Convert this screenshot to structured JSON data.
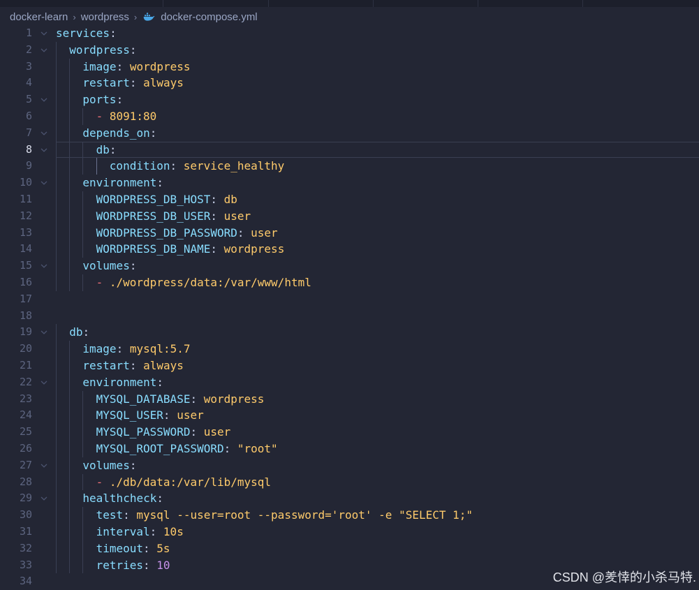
{
  "breadcrumb": {
    "items": [
      "docker-learn",
      "wordpress"
    ],
    "file": "docker-compose.yml",
    "file_icon": "docker-whale-icon"
  },
  "editor": {
    "active_line": 8,
    "lines": [
      {
        "no": "1",
        "indent": 0,
        "seg": [
          [
            "k",
            "services"
          ],
          [
            "p",
            ":"
          ]
        ],
        "fold": true
      },
      {
        "no": "2",
        "indent": 1,
        "seg": [
          [
            "k",
            "wordpress"
          ],
          [
            "p",
            ":"
          ]
        ],
        "fold": true
      },
      {
        "no": "3",
        "indent": 2,
        "seg": [
          [
            "k",
            "image"
          ],
          [
            "p",
            ": "
          ],
          [
            "v",
            "wordpress"
          ]
        ]
      },
      {
        "no": "4",
        "indent": 2,
        "seg": [
          [
            "k",
            "restart"
          ],
          [
            "p",
            ": "
          ],
          [
            "v",
            "always"
          ]
        ]
      },
      {
        "no": "5",
        "indent": 2,
        "seg": [
          [
            "k",
            "ports"
          ],
          [
            "p",
            ":"
          ]
        ],
        "fold": true
      },
      {
        "no": "6",
        "indent": 3,
        "seg": [
          [
            "dash",
            "- "
          ],
          [
            "v",
            "8091:80"
          ]
        ]
      },
      {
        "no": "7",
        "indent": 2,
        "seg": [
          [
            "k",
            "depends_on"
          ],
          [
            "p",
            ":"
          ]
        ],
        "fold": true
      },
      {
        "no": "8",
        "indent": 3,
        "seg": [
          [
            "k",
            "db"
          ],
          [
            "p",
            ":"
          ]
        ],
        "fold": true
      },
      {
        "no": "9",
        "indent": 4,
        "seg": [
          [
            "k",
            "condition"
          ],
          [
            "p",
            ": "
          ],
          [
            "v",
            "service_healthy"
          ]
        ]
      },
      {
        "no": "10",
        "indent": 2,
        "seg": [
          [
            "k",
            "environment"
          ],
          [
            "p",
            ":"
          ]
        ],
        "fold": true
      },
      {
        "no": "11",
        "indent": 3,
        "seg": [
          [
            "k",
            "WORDPRESS_DB_HOST"
          ],
          [
            "p",
            ": "
          ],
          [
            "v",
            "db"
          ]
        ]
      },
      {
        "no": "12",
        "indent": 3,
        "seg": [
          [
            "k",
            "WORDPRESS_DB_USER"
          ],
          [
            "p",
            ": "
          ],
          [
            "v",
            "user"
          ]
        ]
      },
      {
        "no": "13",
        "indent": 3,
        "seg": [
          [
            "k",
            "WORDPRESS_DB_PASSWORD"
          ],
          [
            "p",
            ": "
          ],
          [
            "v",
            "user"
          ]
        ]
      },
      {
        "no": "14",
        "indent": 3,
        "seg": [
          [
            "k",
            "WORDPRESS_DB_NAME"
          ],
          [
            "p",
            ": "
          ],
          [
            "v",
            "wordpress"
          ]
        ]
      },
      {
        "no": "15",
        "indent": 2,
        "seg": [
          [
            "k",
            "volumes"
          ],
          [
            "p",
            ":"
          ]
        ],
        "fold": true
      },
      {
        "no": "16",
        "indent": 3,
        "seg": [
          [
            "dash",
            "- "
          ],
          [
            "v",
            "./wordpress/data:/var/www/html"
          ]
        ]
      },
      {
        "no": "17",
        "indent": 0,
        "seg": []
      },
      {
        "no": "18",
        "indent": 0,
        "seg": []
      },
      {
        "no": "19",
        "indent": 1,
        "seg": [
          [
            "k",
            "db"
          ],
          [
            "p",
            ":"
          ]
        ],
        "fold": true
      },
      {
        "no": "20",
        "indent": 2,
        "seg": [
          [
            "k",
            "image"
          ],
          [
            "p",
            ": "
          ],
          [
            "v",
            "mysql:5.7"
          ]
        ]
      },
      {
        "no": "21",
        "indent": 2,
        "seg": [
          [
            "k",
            "restart"
          ],
          [
            "p",
            ": "
          ],
          [
            "v",
            "always"
          ]
        ]
      },
      {
        "no": "22",
        "indent": 2,
        "seg": [
          [
            "k",
            "environment"
          ],
          [
            "p",
            ":"
          ]
        ],
        "fold": true
      },
      {
        "no": "23",
        "indent": 3,
        "seg": [
          [
            "k",
            "MYSQL_DATABASE"
          ],
          [
            "p",
            ": "
          ],
          [
            "v",
            "wordpress"
          ]
        ]
      },
      {
        "no": "24",
        "indent": 3,
        "seg": [
          [
            "k",
            "MYSQL_USER"
          ],
          [
            "p",
            ": "
          ],
          [
            "v",
            "user"
          ]
        ]
      },
      {
        "no": "25",
        "indent": 3,
        "seg": [
          [
            "k",
            "MYSQL_PASSWORD"
          ],
          [
            "p",
            ": "
          ],
          [
            "v",
            "user"
          ]
        ]
      },
      {
        "no": "26",
        "indent": 3,
        "seg": [
          [
            "k",
            "MYSQL_ROOT_PASSWORD"
          ],
          [
            "p",
            ": "
          ],
          [
            "v",
            "\"root\""
          ]
        ]
      },
      {
        "no": "27",
        "indent": 2,
        "seg": [
          [
            "k",
            "volumes"
          ],
          [
            "p",
            ":"
          ]
        ],
        "fold": true
      },
      {
        "no": "28",
        "indent": 3,
        "seg": [
          [
            "dash",
            "- "
          ],
          [
            "v",
            "./db/data:/var/lib/mysql"
          ]
        ]
      },
      {
        "no": "29",
        "indent": 2,
        "seg": [
          [
            "k",
            "healthcheck"
          ],
          [
            "p",
            ":"
          ]
        ],
        "fold": true
      },
      {
        "no": "30",
        "indent": 3,
        "seg": [
          [
            "k",
            "test"
          ],
          [
            "p",
            ": "
          ],
          [
            "v",
            "mysql --user=root --password='root' -e \"SELECT 1;\""
          ]
        ]
      },
      {
        "no": "31",
        "indent": 3,
        "seg": [
          [
            "k",
            "interval"
          ],
          [
            "p",
            ": "
          ],
          [
            "v",
            "10s"
          ]
        ]
      },
      {
        "no": "32",
        "indent": 3,
        "seg": [
          [
            "k",
            "timeout"
          ],
          [
            "p",
            ": "
          ],
          [
            "v",
            "5s"
          ]
        ]
      },
      {
        "no": "33",
        "indent": 3,
        "seg": [
          [
            "k",
            "retries"
          ],
          [
            "p",
            ": "
          ],
          [
            "n",
            "10"
          ]
        ]
      },
      {
        "no": "34",
        "indent": 0,
        "seg": []
      }
    ]
  },
  "watermark": "CSDN @羑悻的小杀马特."
}
